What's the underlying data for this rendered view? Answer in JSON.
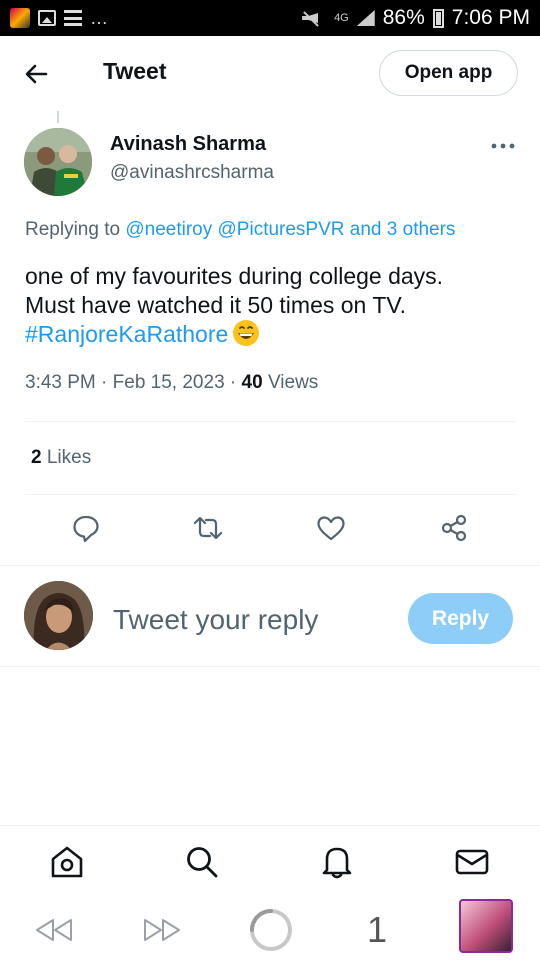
{
  "status_bar": {
    "battery": "86%",
    "time": "7:06 PM",
    "network": "4G"
  },
  "header": {
    "title": "Tweet",
    "open_app_label": "Open app"
  },
  "tweet": {
    "author_name": "Avinash Sharma",
    "author_handle": "@avinashrcsharma",
    "replying_prefix": "Replying to",
    "replying_user1": "@neetiroy",
    "replying_user2": "@PicturesPVR",
    "replying_others": "and 3 others",
    "text_line1": "one of my favourites during college days.",
    "text_line2": "Must have watched it 50 times on TV.",
    "hashtag": "#RanjoreKaRathore",
    "emoji": "grinning-face-emoji",
    "time": "3:43 PM",
    "date": "Feb 15, 2023",
    "views_count": "40",
    "views_label": "Views",
    "likes_count": "2",
    "likes_label": "Likes"
  },
  "actions": [
    "reply-icon",
    "retweet-icon",
    "like-icon",
    "share-icon"
  ],
  "composer": {
    "placeholder": "Tweet your reply",
    "reply_label": "Reply"
  },
  "bottom_nav": [
    "home-icon",
    "search-icon",
    "notifications-icon",
    "messages-icon"
  ],
  "browser_bar": {
    "tab_count": "1"
  },
  "colors": {
    "accent": "#1d9bf0",
    "reply_button": "#8ecdf8",
    "secondary_text": "#536471",
    "primary_text": "#0f1419"
  }
}
